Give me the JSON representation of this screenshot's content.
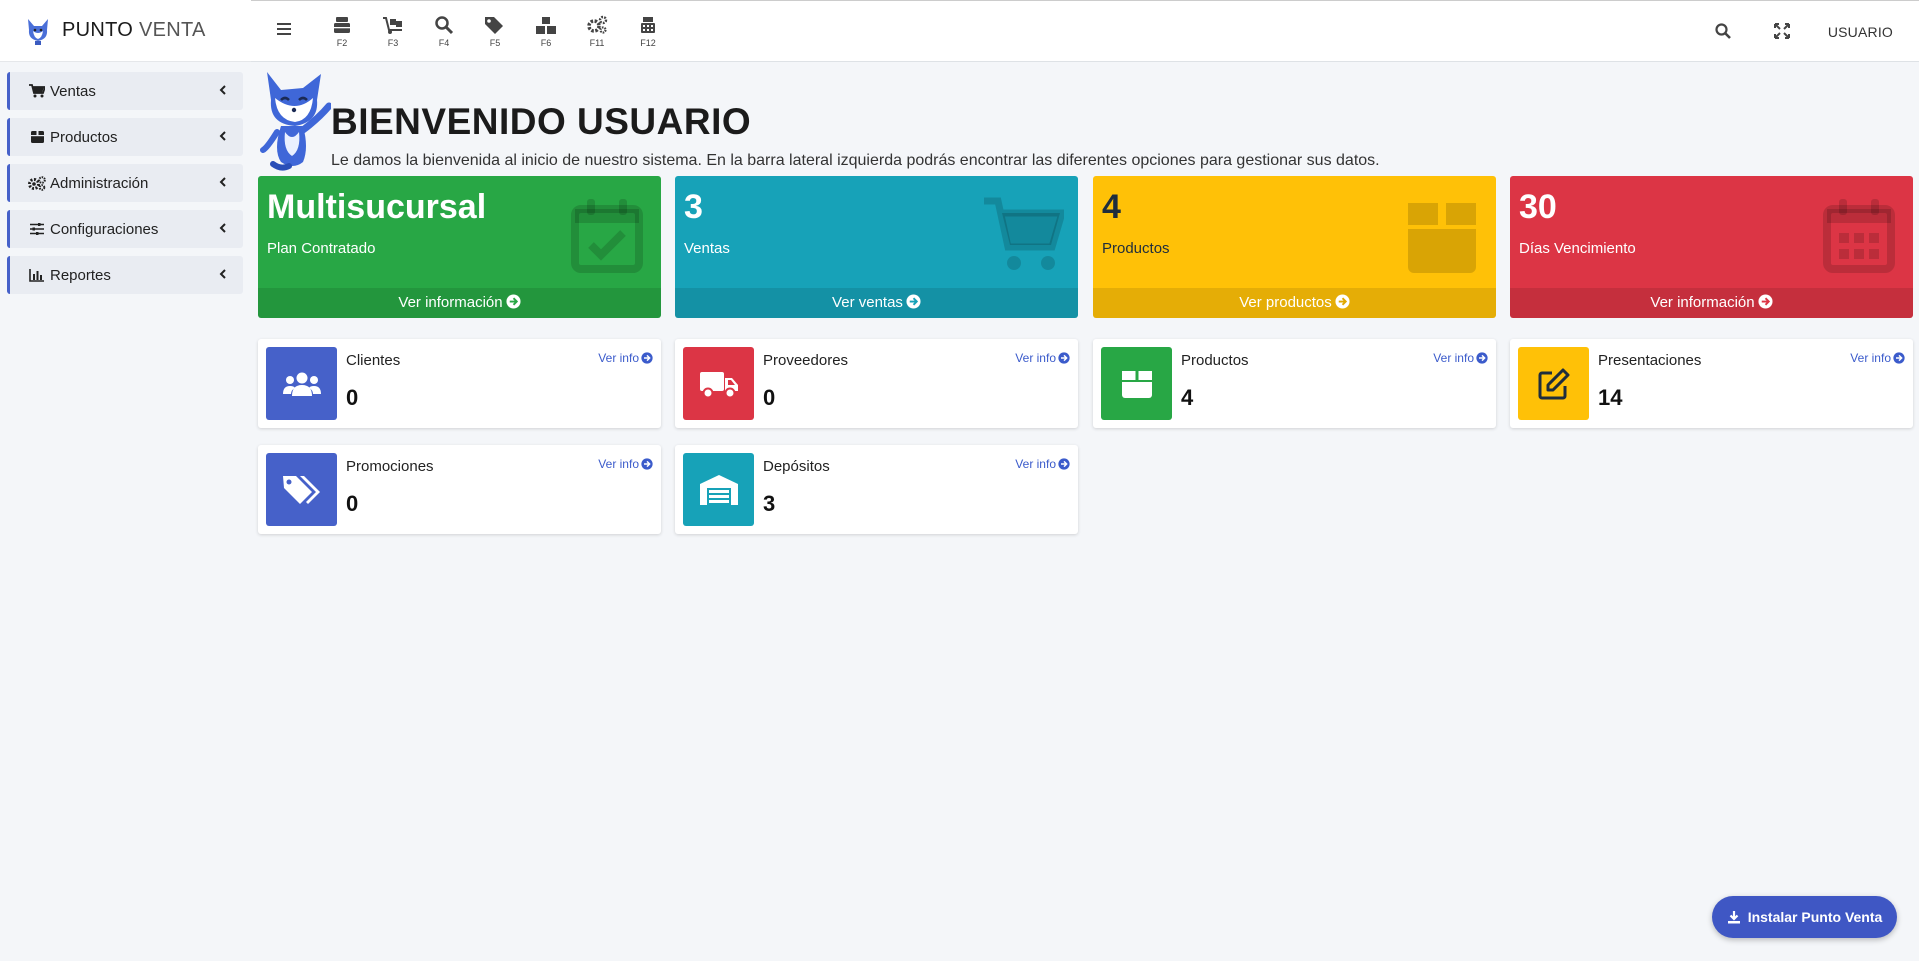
{
  "brand": {
    "name_bold": "PUNTO",
    "name_light": "VENTA"
  },
  "sidebar": {
    "items": [
      {
        "label": "Ventas",
        "icon": "cart-icon"
      },
      {
        "label": "Productos",
        "icon": "box-icon"
      },
      {
        "label": "Administración",
        "icon": "gears-icon"
      },
      {
        "label": "Configuraciones",
        "icon": "sliders-icon"
      },
      {
        "label": "Reportes",
        "icon": "chart-icon"
      }
    ]
  },
  "toolbar": {
    "shortcuts": [
      {
        "key": "F2",
        "icon": "cash-register-icon"
      },
      {
        "key": "F3",
        "icon": "dolly-icon"
      },
      {
        "key": "F4",
        "icon": "search-icon"
      },
      {
        "key": "F5",
        "icon": "tag-icon"
      },
      {
        "key": "F6",
        "icon": "boxes-icon"
      },
      {
        "key": "F11",
        "icon": "gears-icon"
      },
      {
        "key": "F12",
        "icon": "calculator-icon"
      }
    ],
    "user": "USUARIO"
  },
  "welcome": {
    "title": "BIENVENIDO USUARIO",
    "subtitle": "Le damos la bienvenida al inicio de nuestro sistema. En la barra lateral izquierda podrás encontrar las diferentes opciones para gestionar sus datos."
  },
  "summary_cards": [
    {
      "value": "Multisucursal",
      "label": "Plan Contratado",
      "link": "Ver información",
      "color": "#28a745",
      "icon": "calendar-check-icon"
    },
    {
      "value": "3",
      "label": "Ventas",
      "link": "Ver ventas",
      "color": "#17a2b8",
      "icon": "cart-icon"
    },
    {
      "value": "4",
      "label": "Productos",
      "link": "Ver productos",
      "color": "#ffc107",
      "icon": "box-icon"
    },
    {
      "value": "30",
      "label": "Días Vencimiento",
      "link": "Ver información",
      "color": "#dc3545",
      "icon": "calendar-icon"
    }
  ],
  "info_cards": [
    {
      "label": "Clientes",
      "value": "0",
      "link": "Ver info",
      "color": "#4661c9",
      "icon": "users-icon"
    },
    {
      "label": "Proveedores",
      "value": "0",
      "link": "Ver info",
      "color": "#dc3545",
      "icon": "truck-icon"
    },
    {
      "label": "Productos",
      "value": "4",
      "link": "Ver info",
      "color": "#28a745",
      "icon": "box-icon"
    },
    {
      "label": "Presentaciones",
      "value": "14",
      "link": "Ver info",
      "color": "#ffc107",
      "icon": "edit-icon"
    },
    {
      "label": "Promociones",
      "value": "0",
      "link": "Ver info",
      "color": "#4661c9",
      "icon": "tags-icon"
    },
    {
      "label": "Depósitos",
      "value": "3",
      "link": "Ver info",
      "color": "#17a2b8",
      "icon": "warehouse-icon"
    }
  ],
  "install_button": "Instalar Punto Venta"
}
